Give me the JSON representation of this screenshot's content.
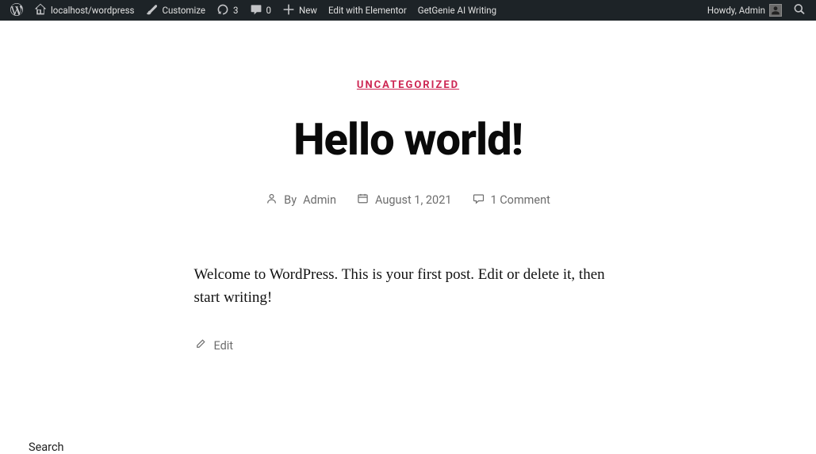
{
  "adminbar": {
    "site_url": "localhost/wordpress",
    "customize": "Customize",
    "updates_count": "3",
    "comments_count": "0",
    "new_label": "New",
    "edit_elementor": "Edit with Elementor",
    "getgenie": "GetGenie AI Writing",
    "greeting": "Howdy, Admin"
  },
  "post": {
    "category": "UNCATEGORIZED",
    "title": "Hello world!",
    "by_label": "By ",
    "author": "Admin",
    "date": "August 1, 2021",
    "comments": "1 Comment",
    "body": "Welcome to WordPress. This is your first post. Edit or delete it, then start writing!",
    "edit_label": "Edit"
  },
  "widget": {
    "search_title": "Search"
  }
}
